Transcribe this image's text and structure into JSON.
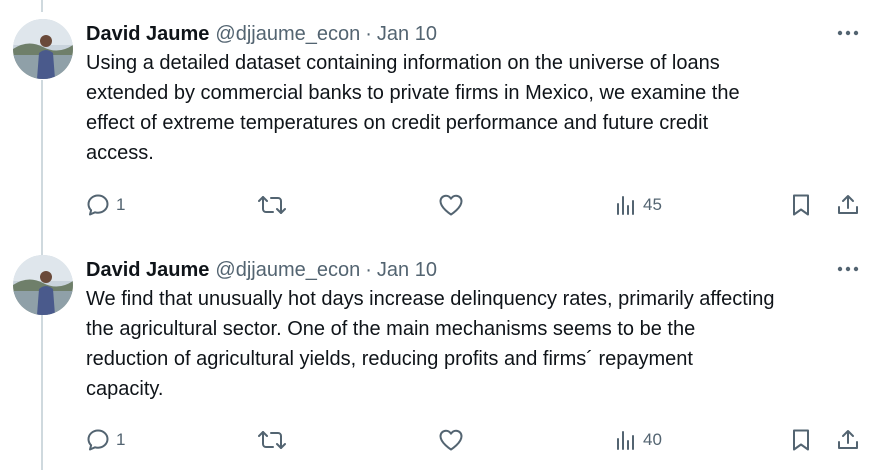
{
  "tweets": [
    {
      "author_name": "David Jaume",
      "handle": "@djjaume_econ",
      "separator": "·",
      "date": "Jan 10",
      "text": "Using a detailed dataset containing information on the universe of loans\nextended by commercial banks to private firms in Mexico, we examine the\neffect of extreme temperatures on credit performance and future credit\naccess.",
      "reply_count": "1",
      "views_count": "45"
    },
    {
      "author_name": "David Jaume",
      "handle": "@djjaume_econ",
      "separator": "·",
      "date": "Jan 10",
      "text": "We find that unusually hot days increase delinquency rates, primarily affecting\nthe agricultural sector. One of the main mechanisms seems to be the\nreduction of agricultural yields, reducing profits and firms´ repayment\ncapacity.",
      "reply_count": "1",
      "views_count": "40"
    }
  ],
  "icons": {
    "reply": "reply-icon",
    "retweet": "retweet-icon",
    "like": "like-icon",
    "views": "views-icon",
    "bookmark": "bookmark-icon",
    "share": "share-icon",
    "more": "more-icon"
  },
  "colors": {
    "text": "#0f1419",
    "secondary": "#536471",
    "thread_line": "#cfd9de"
  }
}
